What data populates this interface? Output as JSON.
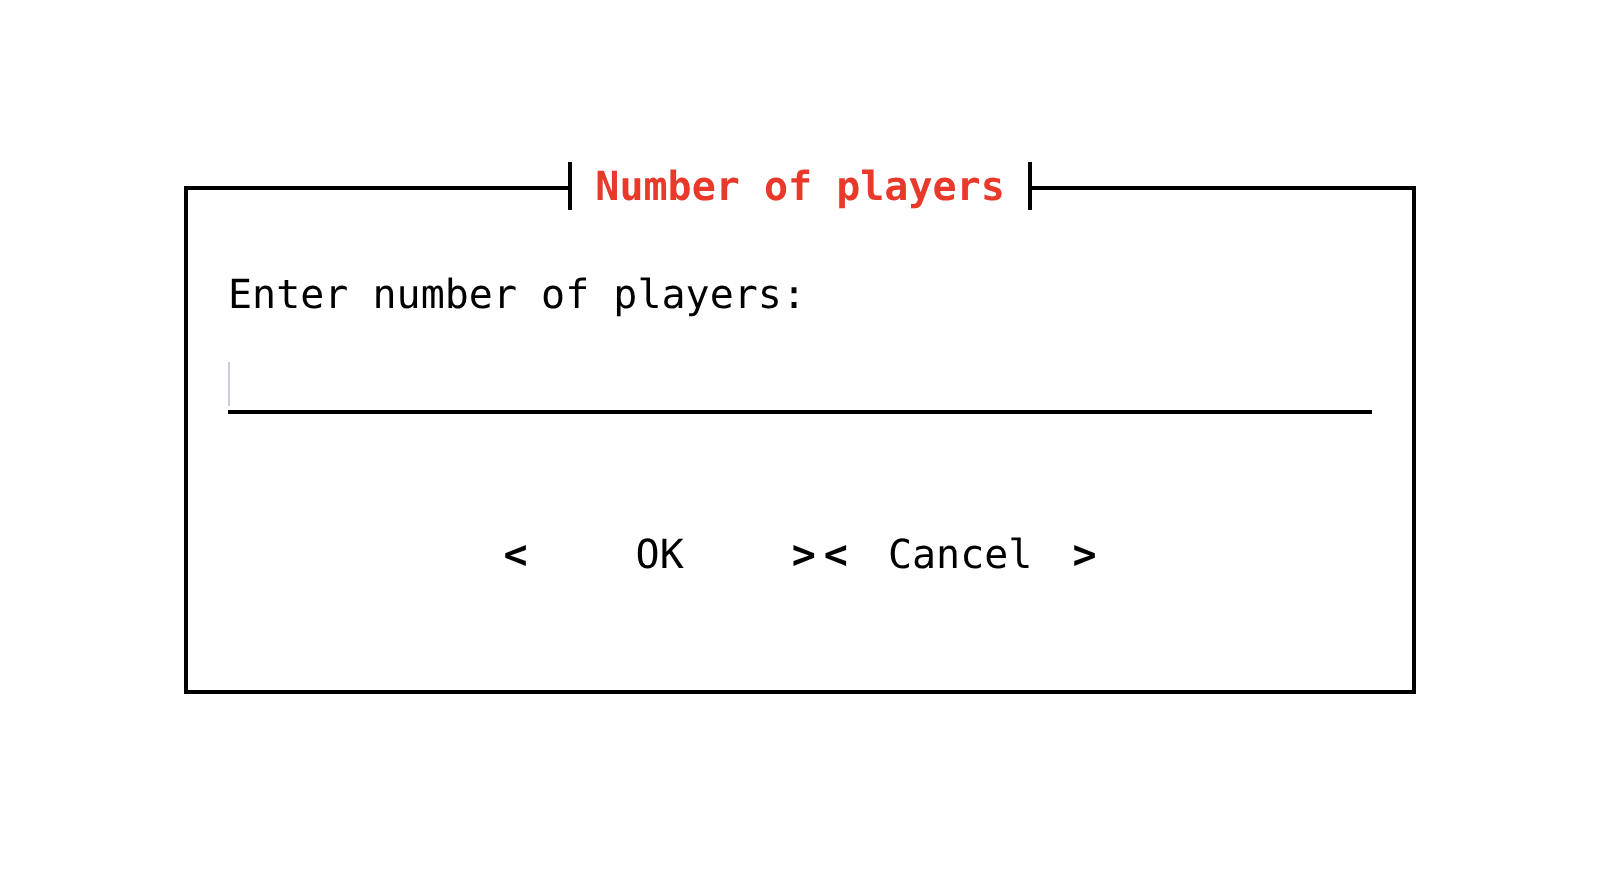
{
  "dialog": {
    "title": "Number of players",
    "prompt": "Enter number of players:"
  },
  "buttons": [
    {
      "open": "<",
      "label": "OK",
      "close": ">"
    },
    {
      "open": "<",
      "label": "Cancel",
      "close": ">"
    }
  ]
}
